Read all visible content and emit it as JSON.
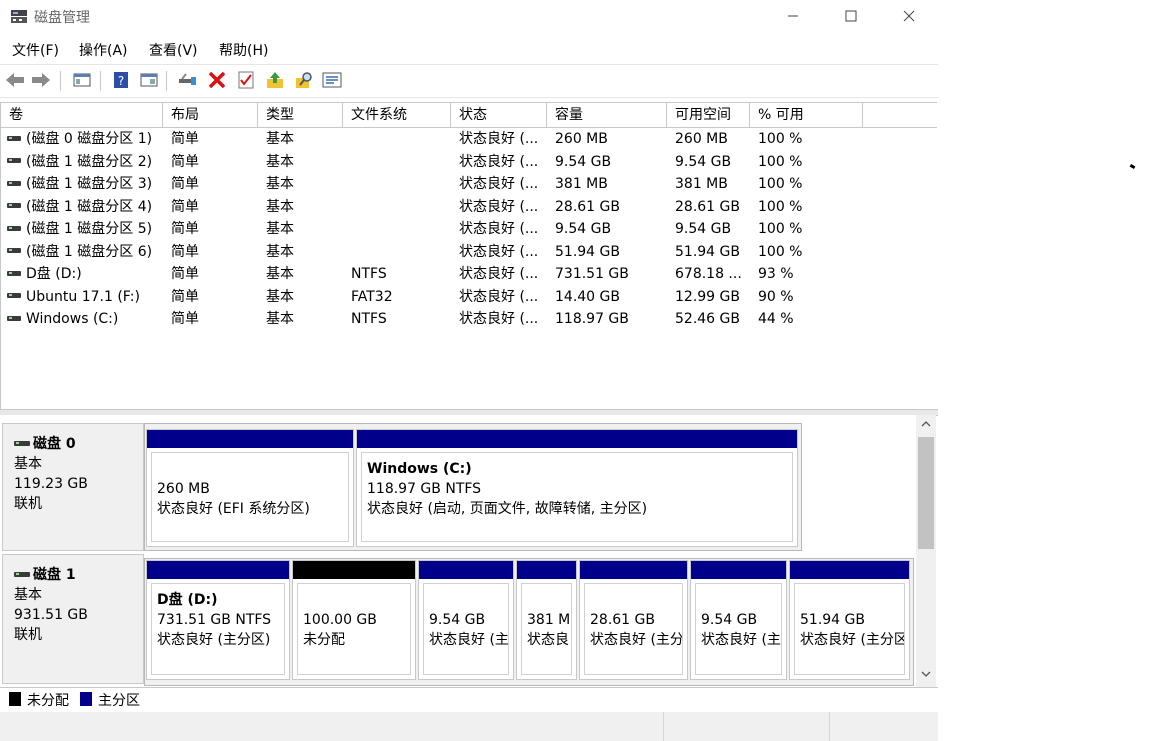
{
  "window": {
    "title": "磁盘管理"
  },
  "menu": [
    "文件(F)",
    "操作(A)",
    "查看(V)",
    "帮助(H)"
  ],
  "columns": [
    "卷",
    "布局",
    "类型",
    "文件系统",
    "状态",
    "容量",
    "可用空间",
    "% 可用"
  ],
  "volumes": [
    [
      "(磁盘 0 磁盘分区 1)",
      "简单",
      "基本",
      "",
      "状态良好 (...",
      "260 MB",
      "260 MB",
      "100 %"
    ],
    [
      "(磁盘 1 磁盘分区 2)",
      "简单",
      "基本",
      "",
      "状态良好 (...",
      "9.54 GB",
      "9.54 GB",
      "100 %"
    ],
    [
      "(磁盘 1 磁盘分区 3)",
      "简单",
      "基本",
      "",
      "状态良好 (...",
      "381 MB",
      "381 MB",
      "100 %"
    ],
    [
      "(磁盘 1 磁盘分区 4)",
      "简单",
      "基本",
      "",
      "状态良好 (...",
      "28.61 GB",
      "28.61 GB",
      "100 %"
    ],
    [
      "(磁盘 1 磁盘分区 5)",
      "简单",
      "基本",
      "",
      "状态良好 (...",
      "9.54 GB",
      "9.54 GB",
      "100 %"
    ],
    [
      "(磁盘 1 磁盘分区 6)",
      "简单",
      "基本",
      "",
      "状态良好 (...",
      "51.94 GB",
      "51.94 GB",
      "100 %"
    ],
    [
      "D盘 (D:)",
      "简单",
      "基本",
      "NTFS",
      "状态良好 (...",
      "731.51 GB",
      "678.18 ...",
      "93 %"
    ],
    [
      "Ubuntu 17.1 (F:)",
      "简单",
      "基本",
      "FAT32",
      "状态良好 (...",
      "14.40 GB",
      "12.99 GB",
      "90 %"
    ],
    [
      "Windows (C:)",
      "简单",
      "基本",
      "NTFS",
      "状态良好 (...",
      "118.97 GB",
      "52.46 GB",
      "44 %"
    ]
  ],
  "disks": [
    {
      "name": "磁盘 0",
      "type": "基本",
      "size": "119.23 GB",
      "status": "联机",
      "partitions": [
        {
          "title": "",
          "line1": "260 MB",
          "line2": "状态良好 (EFI 系统分区)",
          "kind": "primary"
        },
        {
          "title": "Windows  (C:)",
          "line1": "118.97 GB NTFS",
          "line2": "状态良好 (启动, 页面文件, 故障转储, 主分区)",
          "kind": "primary"
        }
      ]
    },
    {
      "name": "磁盘 1",
      "type": "基本",
      "size": "931.51 GB",
      "status": "联机",
      "partitions": [
        {
          "title": "D盘  (D:)",
          "line1": "731.51 GB NTFS",
          "line2": "状态良好 (主分区)",
          "kind": "primary"
        },
        {
          "title": "",
          "line1": "100.00 GB",
          "line2": "未分配",
          "kind": "unallocated"
        },
        {
          "title": "",
          "line1": "9.54 GB",
          "line2": "状态良好 (主",
          "kind": "primary"
        },
        {
          "title": "",
          "line1": "381 M",
          "line2": "状态良",
          "kind": "primary"
        },
        {
          "title": "",
          "line1": "28.61 GB",
          "line2": "状态良好 (主分",
          "kind": "primary"
        },
        {
          "title": "",
          "line1": "9.54 GB",
          "line2": "状态良好 (主",
          "kind": "primary"
        },
        {
          "title": "",
          "line1": "51.94 GB",
          "line2": "状态良好 (主分区",
          "kind": "primary"
        }
      ]
    }
  ],
  "legend": [
    {
      "label": "未分配",
      "color": "#000000"
    },
    {
      "label": "主分区",
      "color": "#00008b"
    }
  ],
  "colors": {
    "primary": "#00008b",
    "unallocated": "#000000"
  }
}
